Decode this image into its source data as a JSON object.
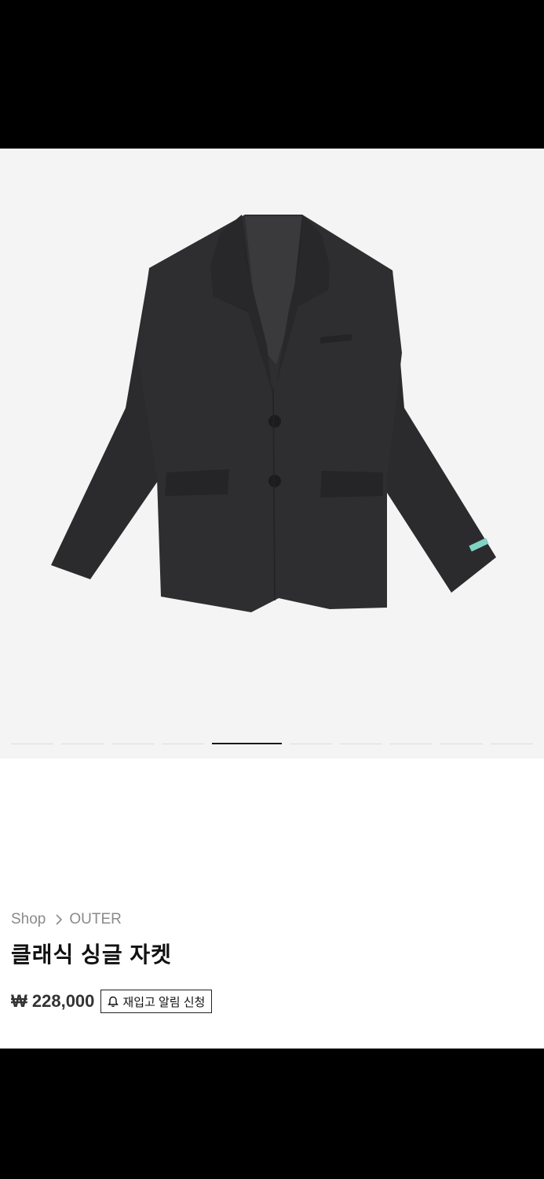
{
  "product": {
    "image_alt": "클래식 싱글 자켓",
    "gallery": {
      "total": 10,
      "active_index": 4
    },
    "breadcrumb": {
      "root": "Shop",
      "category": "OUTER"
    },
    "title": "클래식 싱글 자켓",
    "price": "₩ 228,000",
    "restock_button": "재입고 알림 신청"
  },
  "colors": {
    "background": "#f4f4f4",
    "jacket": "#2c2c2e",
    "tag_accent": "#7fd3c4",
    "breadcrumb_text": "#8a8a8a"
  },
  "icons": {
    "chevron": "chevron-right-icon",
    "bell": "bell-icon"
  }
}
